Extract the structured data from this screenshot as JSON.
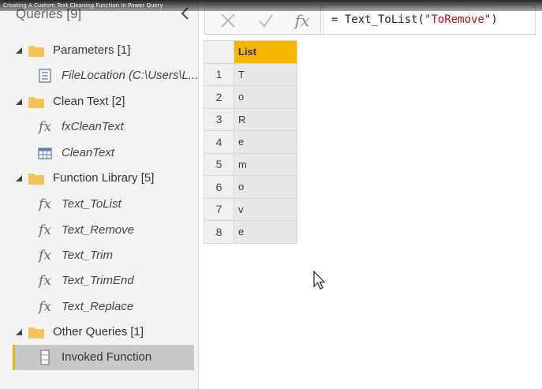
{
  "video_title": "Creating A Custom Text Cleaning Function In Power Query",
  "queries_pane": {
    "title": "Queries [9]",
    "groups": [
      {
        "label": "Parameters [1]",
        "items": [
          {
            "label": "FileLocation (C:\\Users\\L...",
            "icon": "parameter-icon"
          }
        ]
      },
      {
        "label": "Clean Text [2]",
        "items": [
          {
            "label": "fxCleanText",
            "icon": "function-icon"
          },
          {
            "label": "CleanText",
            "icon": "table-icon"
          }
        ]
      },
      {
        "label": "Function Library [5]",
        "items": [
          {
            "label": "Text_ToList",
            "icon": "function-icon"
          },
          {
            "label": "Text_Remove",
            "icon": "function-icon"
          },
          {
            "label": "Text_Trim",
            "icon": "function-icon"
          },
          {
            "label": "Text_TrimEnd",
            "icon": "function-icon"
          },
          {
            "label": "Text_Replace",
            "icon": "function-icon"
          }
        ]
      },
      {
        "label": "Other Queries [1]",
        "items": [
          {
            "label": "Invoked Function",
            "icon": "list-icon",
            "selected": true
          }
        ]
      }
    ]
  },
  "formula_bar": {
    "fx_label": "fx",
    "prefix": "= Text_ToList(",
    "argument": "\"ToRemove\"",
    "suffix": ")"
  },
  "grid": {
    "column_header": "List",
    "rows": [
      {
        "num": "1",
        "value": "T"
      },
      {
        "num": "2",
        "value": "o"
      },
      {
        "num": "3",
        "value": "R"
      },
      {
        "num": "4",
        "value": "e"
      },
      {
        "num": "5",
        "value": "m"
      },
      {
        "num": "6",
        "value": "o"
      },
      {
        "num": "7",
        "value": "v"
      },
      {
        "num": "8",
        "value": "e"
      }
    ]
  },
  "colors": {
    "column_header_bg": "#f4b400",
    "selection_accent": "#e3b400",
    "folder": "#f2c45a",
    "string_literal": "#a31515"
  }
}
